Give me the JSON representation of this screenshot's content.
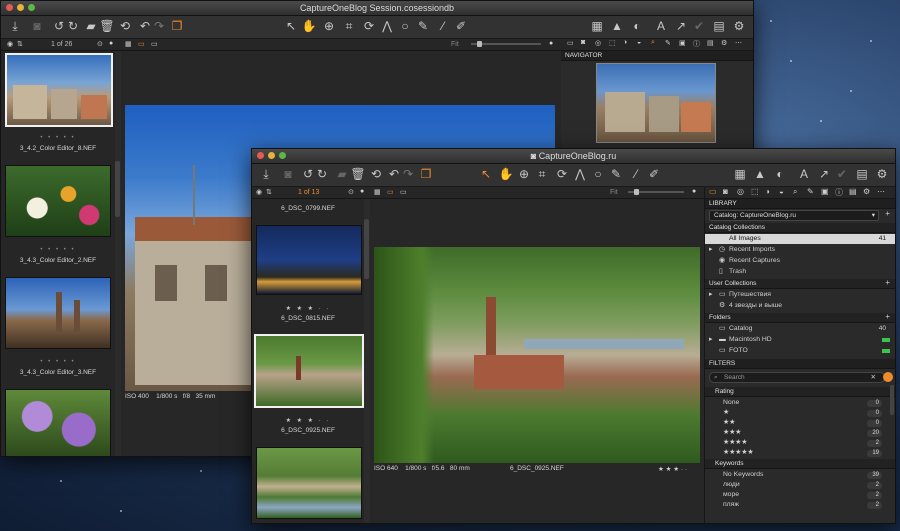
{
  "win1": {
    "title": "CaptureOneBlog Session.cosessiondb",
    "counter": "1 of 26",
    "navigator": "NAVIGATOR",
    "fit": "Fit",
    "thumbs": [
      {
        "name": "3_4.2_Color Editor_8.NEF"
      },
      {
        "name": "3_4.3_Color Editor_2.NEF"
      },
      {
        "name": "3_4.3_Color Editor_3.NEF"
      }
    ],
    "stars": "• • • • •",
    "meta": {
      "iso": "ISO 400",
      "shutter": "1/800 s",
      "aperture": "f/8",
      "focal": "35 mm"
    }
  },
  "win2": {
    "title": "CaptureOneBlog.ru",
    "counter": "1 of 13",
    "fit": "Fit",
    "thumbs": [
      {
        "name": "6_DSC_0799.NEF",
        "stars": ""
      },
      {
        "name": "6_DSC_0815.NEF",
        "stars": "★ ★ ★ · ·"
      },
      {
        "name": "6_DSC_0925.NEF",
        "stars": "★ ★ ★ · ·"
      }
    ],
    "meta": {
      "iso": "ISO 640",
      "shutter": "1/800 s",
      "aperture": "f/5.6",
      "focal": "80 mm",
      "file": "6_DSC_0925.NEF",
      "rating": "★ ★ ★ · ·"
    },
    "library": {
      "header": "LIBRARY",
      "catalog": "Catalog: CaptureOneBlog.ru",
      "collections_header": "Catalog Collections",
      "collections": [
        {
          "label": "All Images",
          "count": "41",
          "selected": true
        },
        {
          "label": "Recent Imports",
          "count": ""
        },
        {
          "label": "Recent Captures",
          "count": ""
        },
        {
          "label": "Trash",
          "count": ""
        }
      ],
      "user_header": "User Collections",
      "user": [
        {
          "label": "Путешествия"
        },
        {
          "label": "4 звезды и выше"
        }
      ],
      "folders_header": "Folders",
      "folders": [
        {
          "label": "Catalog",
          "count": "40"
        },
        {
          "label": "Macintosh HD",
          "count": ""
        },
        {
          "label": "FOTO",
          "count": ""
        }
      ]
    },
    "filters": {
      "header": "FILTERS",
      "search_placeholder": "Search",
      "rating_header": "Rating",
      "rating": [
        {
          "label": "None",
          "count": "0"
        },
        {
          "label": "★",
          "count": "0"
        },
        {
          "label": "★★",
          "count": "0"
        },
        {
          "label": "★★★",
          "count": "20"
        },
        {
          "label": "★★★★",
          "count": "2"
        },
        {
          "label": "★★★★★",
          "count": "19"
        }
      ],
      "keywords_header": "Keywords",
      "keywords": [
        {
          "label": "No Keywords",
          "count": "39"
        },
        {
          "label": "люди",
          "count": "2"
        },
        {
          "label": "море",
          "count": "2"
        },
        {
          "label": "пляж",
          "count": "2"
        }
      ]
    }
  },
  "colors": {
    "accent": "#ef8a2d",
    "panel": "#2a2a2a",
    "green": "#3ec24a"
  }
}
